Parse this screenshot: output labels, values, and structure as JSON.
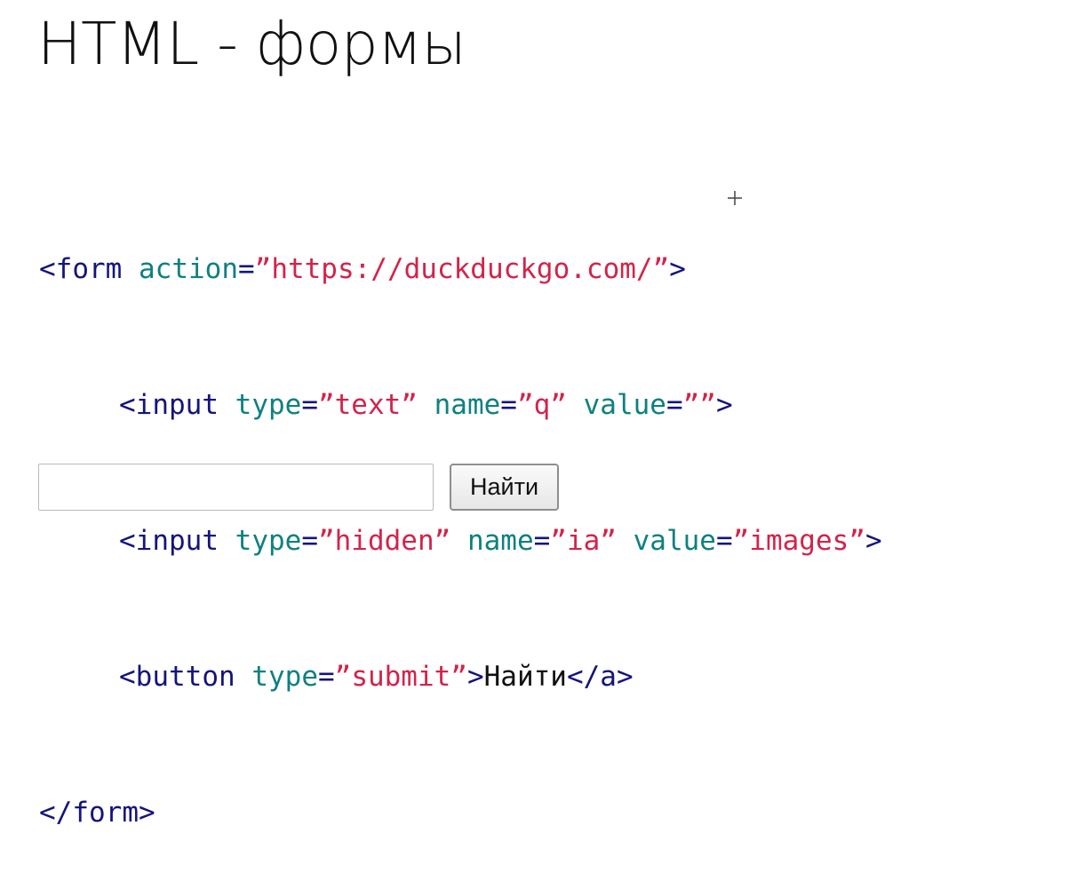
{
  "title": "HTML - формы",
  "code": {
    "line1": {
      "tag_open": "<form",
      "attr": "action",
      "eq": "=",
      "value": "”https://duckduckgo.com/”",
      "tag_close": ">"
    },
    "line2": {
      "tag_open": "<input",
      "attr1": "type",
      "eq1": "=",
      "value1": "”text”",
      "attr2": "name",
      "eq2": "=",
      "value2": "”q”",
      "attr3": "value",
      "eq3": "=",
      "value3": "””",
      "tag_close": ">"
    },
    "line3": {
      "tag_open": "<input",
      "attr1": "type",
      "eq1": "=",
      "value1": "”hidden”",
      "attr2": "name",
      "eq2": "=",
      "value2": "”ia”",
      "attr3": "value",
      "eq3": "=",
      "value3": "”images”",
      "tag_close": ">"
    },
    "line4": {
      "tag_open": "<button",
      "attr1": "type",
      "eq1": "=",
      "value1": "”submit”",
      "tag_mid": ">",
      "text": "Найти",
      "tag_close": "</a>"
    },
    "line5": {
      "tag": "</form>"
    }
  },
  "demo_form": {
    "input_value": "",
    "button_label": "Найти"
  },
  "icons": {
    "cursor": "crosshair-cursor-icon"
  }
}
